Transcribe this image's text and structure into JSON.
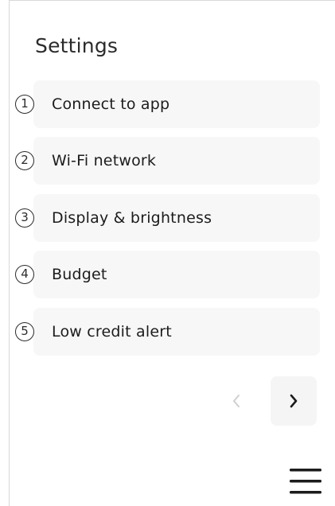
{
  "header": {
    "title": "Settings"
  },
  "menu": {
    "items": [
      {
        "number": "1",
        "label": "Connect to app"
      },
      {
        "number": "2",
        "label": "Wi-Fi network"
      },
      {
        "number": "3",
        "label": "Display & brightness"
      },
      {
        "number": "4",
        "label": "Budget"
      },
      {
        "number": "5",
        "label": "Low credit alert"
      }
    ]
  },
  "pagination": {
    "prev_icon": "chevron-left-icon",
    "next_icon": "chevron-right-icon",
    "prev_enabled": false,
    "next_enabled": true
  },
  "footer": {
    "menu_icon": "hamburger-menu-icon"
  },
  "colors": {
    "item_background": "#f7f7f7",
    "text": "#1c1c1c",
    "disabled_icon": "#d0d0d0"
  }
}
